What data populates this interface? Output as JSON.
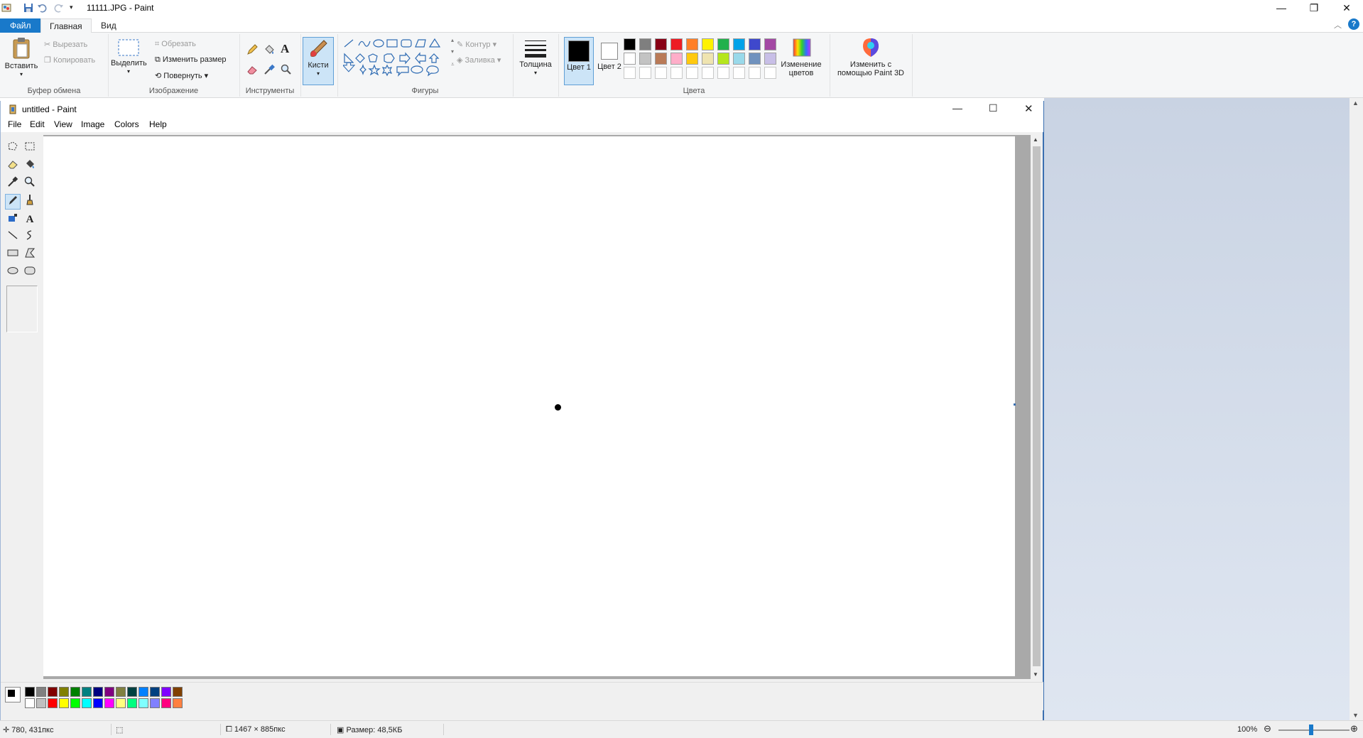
{
  "window": {
    "title": "11111.JPG - Paint",
    "min_icon": "minimize-icon",
    "restore_icon": "restore-icon",
    "close_icon": "close-icon"
  },
  "ribbon_tabs": {
    "file": "Файл",
    "home": "Главная",
    "view": "Вид"
  },
  "ribbon": {
    "clipboard": {
      "paste": "Вставить",
      "cut": "Вырезать",
      "copy": "Копировать",
      "label": "Буфер обмена"
    },
    "image": {
      "select": "Выделить",
      "crop": "Обрезать",
      "resize": "Изменить размер",
      "rotate": "Повернуть",
      "label": "Изображение"
    },
    "tools": {
      "label": "Инструменты"
    },
    "brushes": {
      "label": "Кисти"
    },
    "shapes": {
      "outline": "Контур",
      "fill": "Заливка",
      "label": "Фигуры"
    },
    "size": {
      "label": "Толщина"
    },
    "colors": {
      "color1": "Цвет 1",
      "color2": "Цвет 2",
      "edit": "Изменение цветов",
      "paint3d": "Изменить с помощью Paint 3D",
      "label": "Цвета",
      "row1": [
        "#000000",
        "#7f7f7f",
        "#880015",
        "#ed1c24",
        "#ff7f27",
        "#fff200",
        "#22b14c",
        "#00a2e8",
        "#3f48cc",
        "#a349a4"
      ],
      "row2": [
        "#ffffff",
        "#c3c3c3",
        "#b97a57",
        "#ffaec9",
        "#ffc90e",
        "#efe4b0",
        "#b5e61d",
        "#99d9ea",
        "#7092be",
        "#c8bfe7"
      ]
    }
  },
  "inner": {
    "title": "untitled - Paint",
    "menu": [
      "File",
      "Edit",
      "View",
      "Image",
      "Colors",
      "Help"
    ],
    "palette_row1": [
      "#000000",
      "#808080",
      "#800000",
      "#808000",
      "#008000",
      "#008080",
      "#000080",
      "#800080",
      "#808040",
      "#004040",
      "#0080ff",
      "#004080",
      "#8000ff",
      "#804000"
    ],
    "palette_row2": [
      "#ffffff",
      "#c0c0c0",
      "#ff0000",
      "#ffff00",
      "#00ff00",
      "#00ffff",
      "#0000ff",
      "#ff00ff",
      "#ffff80",
      "#00ff80",
      "#80ffff",
      "#8080ff",
      "#ff0080",
      "#ff8040"
    ]
  },
  "status": {
    "cursor": "780, 431пкс",
    "dimensions": "1467 × 885пкс",
    "size": "Размер: 48,5КБ",
    "zoom": "100%"
  }
}
